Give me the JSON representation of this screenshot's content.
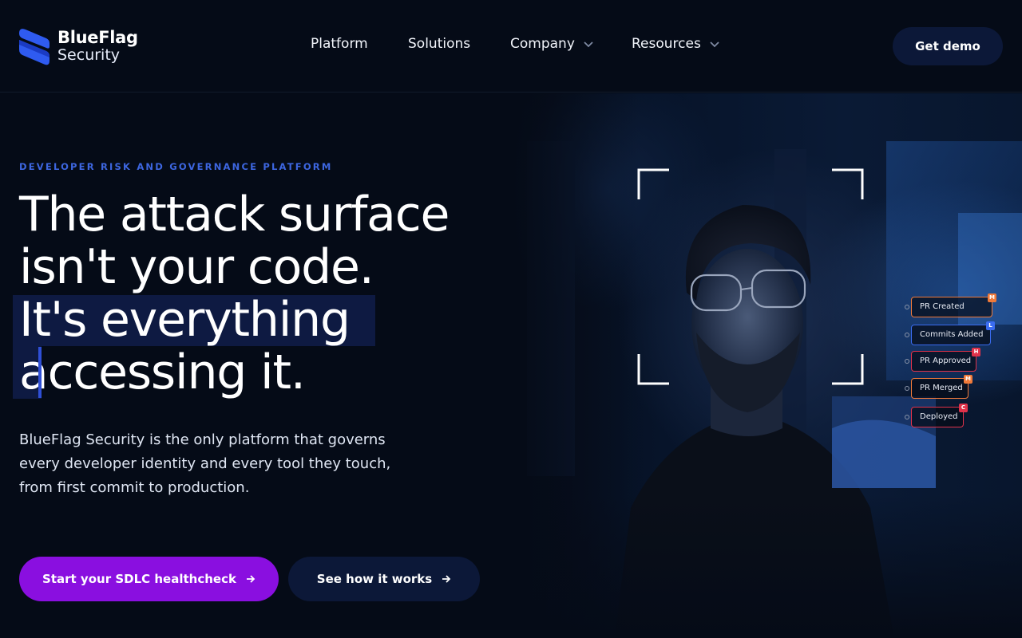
{
  "brand": {
    "name_line1": "BlueFlag",
    "name_line2": "Security",
    "accent": "#2f5bf0"
  },
  "nav": {
    "items": [
      {
        "label": "Platform",
        "has_dropdown": false
      },
      {
        "label": "Solutions",
        "has_dropdown": false
      },
      {
        "label": "Company",
        "has_dropdown": true
      },
      {
        "label": "Resources",
        "has_dropdown": true
      }
    ],
    "cta_label": "Get demo"
  },
  "hero": {
    "eyebrow": "DEVELOPER RISK AND GOVERNANCE PLATFORM",
    "headline_lines": [
      "The attack surface",
      "isn't your code.",
      "It's everything",
      "accessing it."
    ],
    "description_lines": [
      "BlueFlag Security is the only platform that governs",
      "every developer identity and every tool they touch,",
      "from first commit to production."
    ],
    "primary_cta": "Start your SDLC healthcheck",
    "secondary_cta": "See how it works"
  },
  "pipeline": {
    "steps": [
      {
        "label": "PR Created",
        "badge": "M",
        "color": "#f07a3a"
      },
      {
        "label": "Commits Added",
        "badge": "L",
        "color": "#3a6cf0"
      },
      {
        "label": "PR Approved",
        "badge": "H",
        "color": "#e0324a"
      },
      {
        "label": "PR Merged",
        "badge": "M",
        "color": "#f07a3a"
      },
      {
        "label": "Deployed",
        "badge": "C",
        "color": "#e0324a"
      }
    ]
  },
  "colors": {
    "background": "#050b17",
    "primary_button": "#8a0fe0",
    "secondary_button": "#0c1838",
    "eyebrow": "#3d66e0"
  }
}
